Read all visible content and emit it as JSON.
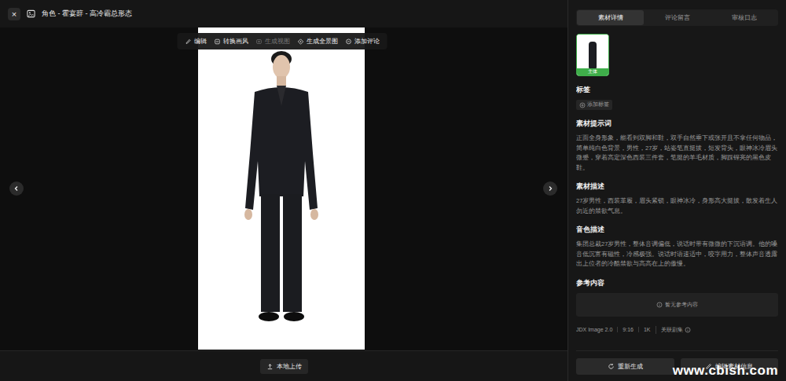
{
  "window": {
    "title": "角色 - 霍宴辞 - 高冷霸总形态",
    "close": "×"
  },
  "toolbar": [
    {
      "label": "编辑",
      "disabled": false
    },
    {
      "label": "转换画风",
      "disabled": false
    },
    {
      "label": "生成视图",
      "disabled": true
    },
    {
      "label": "生成全景图",
      "disabled": false
    },
    {
      "label": "添加评论",
      "disabled": false
    }
  ],
  "upload_button": "本地上传",
  "panel": {
    "tabs": [
      {
        "label": "素材详情",
        "selected": true
      },
      {
        "label": "评论留言",
        "selected": false
      },
      {
        "label": "审核日志",
        "selected": false
      }
    ],
    "thumbnails": [
      {
        "label": "主体",
        "selected": true
      }
    ],
    "tags": {
      "title": "标签",
      "add": "添加标签"
    },
    "sections": [
      {
        "title": "素材提示词",
        "text": "正面全身形象，能看到双脚和鞋，双手自然垂下或张开且不拿任何物品，简单纯白色背景，男性，27岁，站姿笔直挺拔，短发背头，眼神冰冷眉头微蹙，穿着高定深色西装三件套，笔挺的羊毛材质，脚踩锃亮的黑色皮鞋。"
      },
      {
        "title": "素材描述",
        "text": "27岁男性，西装革履，眉头紧锁，眼神冰冷，身形高大挺拔，散发着生人勿近的禁欲气息。"
      },
      {
        "title": "音色描述",
        "text": "集团总裁27岁男性，整体音调偏低，说话时带有微微的下沉语调。他的嗓音低沉富有磁性，冷感极强。说话时语速适中，咬字用力，整体声音透露出上位者的冷酷禁欲与高高在上的傲慢。"
      }
    ],
    "reference": {
      "title": "参考内容",
      "empty": "暂无参考内容"
    },
    "meta": [
      "JDX Image 2.0",
      "9:16",
      "1K",
      "关联剧集"
    ],
    "actions": [
      "重新生成",
      "编辑素材信息"
    ]
  },
  "watermark": "www.cbish.com"
}
